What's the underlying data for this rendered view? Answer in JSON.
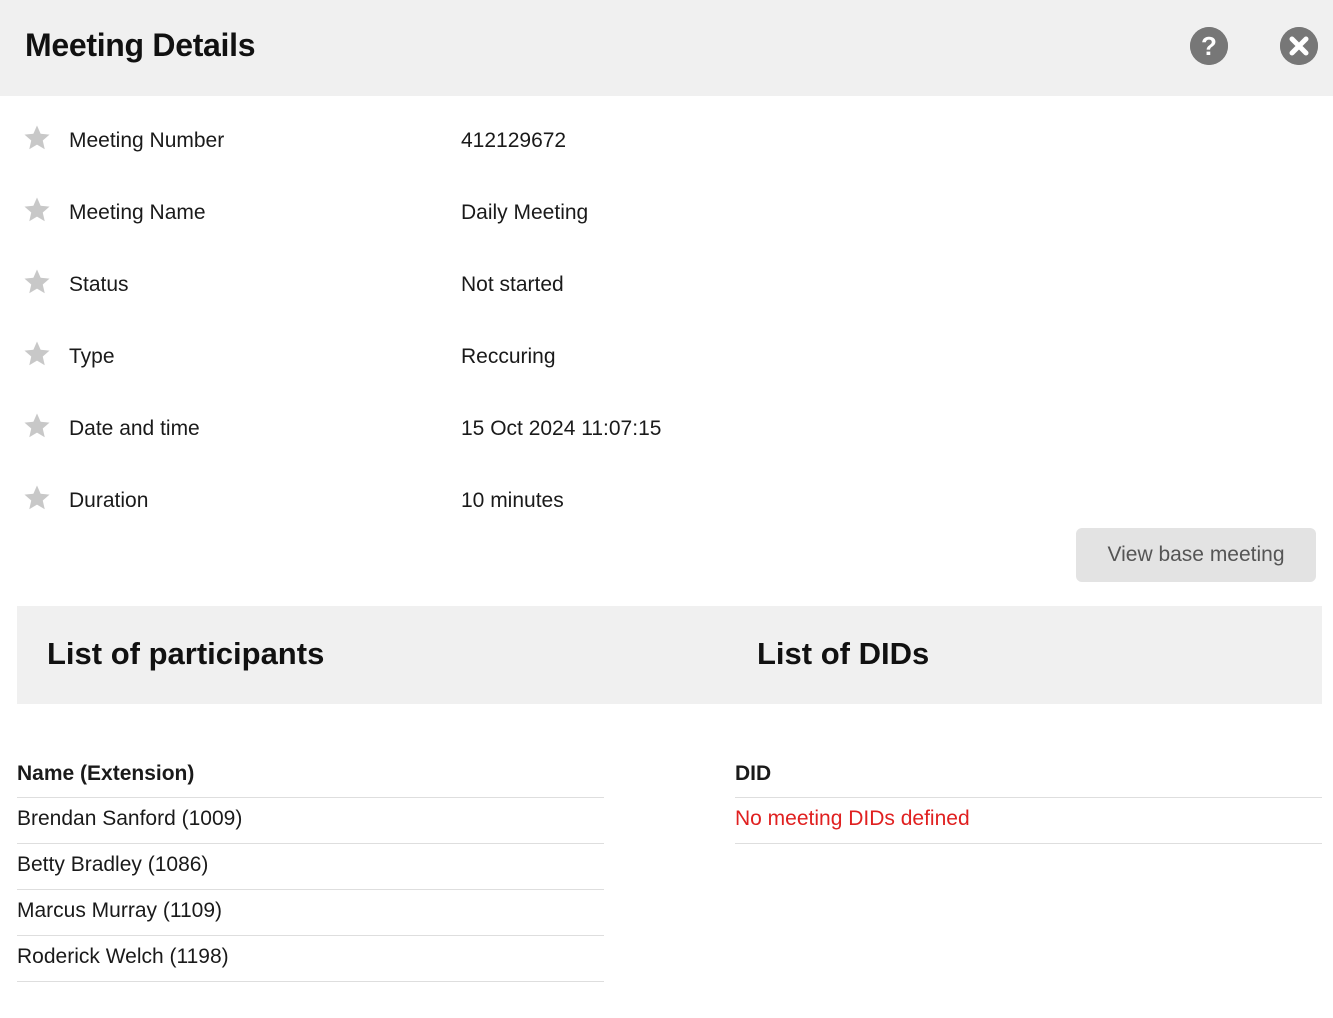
{
  "header": {
    "title": "Meeting Details",
    "help_icon": "question-circle-icon",
    "close_icon": "close-circle-icon"
  },
  "details": [
    {
      "label": "Meeting Number",
      "value": "412129672"
    },
    {
      "label": "Meeting Name",
      "value": "Daily Meeting"
    },
    {
      "label": "Status",
      "value": "Not started"
    },
    {
      "label": "Type",
      "value": "Reccuring"
    },
    {
      "label": "Date and time",
      "value": "15 Oct 2024 11:07:15"
    },
    {
      "label": "Duration",
      "value": "10 minutes"
    }
  ],
  "actions": {
    "view_base_meeting": "View base meeting"
  },
  "participants": {
    "title": "List of participants",
    "column": "Name (Extension)",
    "rows": [
      "Brendan Sanford (1009)",
      "Betty Bradley (1086)",
      "Marcus Murray (1109)",
      "Roderick Welch (1198)"
    ]
  },
  "dids": {
    "title": "List of DIDs",
    "column": "DID",
    "empty_message": "No meeting DIDs defined"
  },
  "colors": {
    "header_bg": "#f0f0f0",
    "icon_gray": "#777777",
    "star_gray": "#c8c8c8",
    "error_red": "#e02020",
    "button_bg": "#e3e3e3"
  }
}
